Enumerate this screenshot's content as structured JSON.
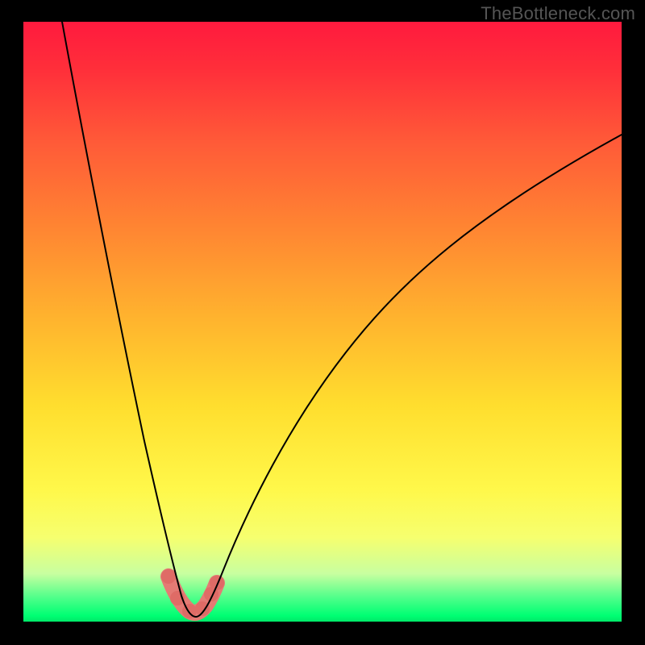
{
  "watermark": "TheBottleneck.com",
  "chart_data": {
    "type": "line",
    "title": "",
    "xlabel": "",
    "ylabel": "",
    "xlim": [
      0,
      100
    ],
    "ylim": [
      0,
      100
    ],
    "grid": false,
    "legend": false,
    "series": [
      {
        "name": "bottleneck-curve",
        "x": [
          0,
          5,
          10,
          15,
          20,
          24,
          26,
          27.5,
          29,
          31,
          32,
          36,
          42,
          50,
          60,
          72,
          85,
          100
        ],
        "values": [
          100,
          83,
          65,
          46,
          27,
          8,
          2,
          0.5,
          0.5,
          2,
          5,
          15,
          28,
          42,
          55,
          66,
          75,
          82
        ]
      }
    ],
    "optimal_region": {
      "x_start": 24,
      "x_end": 32,
      "points_x": [
        24.2,
        25.4,
        27.0,
        28.8,
        30.0,
        31.0
      ],
      "points_y": [
        7.5,
        3.0,
        0.8,
        0.8,
        2.2,
        4.8
      ]
    },
    "background_gradient": {
      "top": "#ff1a3e",
      "bottom": "#00e868"
    }
  }
}
